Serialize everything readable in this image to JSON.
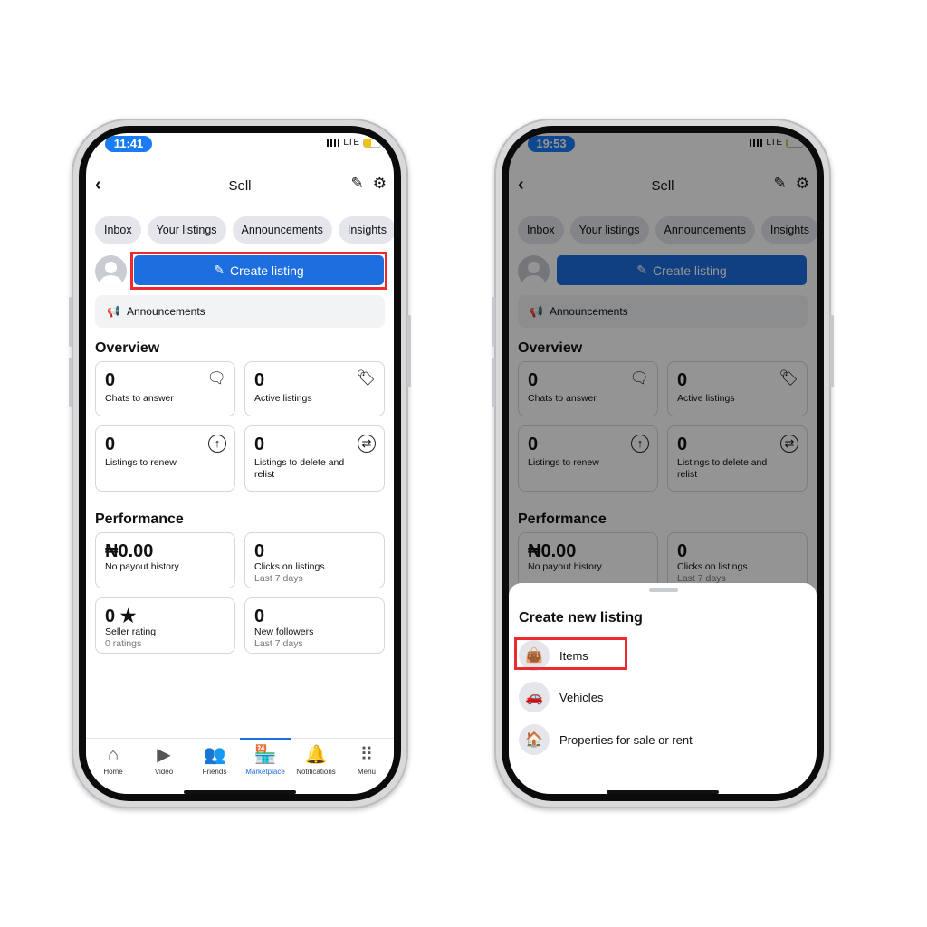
{
  "phones": [
    {
      "status": {
        "time": "11:41",
        "network": "LTE",
        "battery_level": 0.45,
        "battery_color": "#f5c400"
      },
      "header": {
        "title": "Sell",
        "back_icon": "‹",
        "edit_icon": "✎",
        "settings_icon": "⚙"
      },
      "tabs": [
        "Inbox",
        "Your listings",
        "Announcements",
        "Insights"
      ],
      "create_listing": {
        "label": "Create listing",
        "icon": "✎",
        "highlighted": true
      },
      "announcements": {
        "label": "Announcements",
        "icon": "📢"
      },
      "overview": {
        "title": "Overview",
        "cards": [
          {
            "value": "0",
            "label": "Chats to answer",
            "icon": "🗨"
          },
          {
            "value": "0",
            "label": "Active listings",
            "icon": "🏷"
          },
          {
            "value": "0",
            "label": "Listings to renew",
            "icon": "↑"
          },
          {
            "value": "0",
            "label": "Listings to delete and relist",
            "icon": "⇄"
          }
        ]
      },
      "performance": {
        "title": "Performance",
        "cards": [
          {
            "value": "₦0.00",
            "label": "No payout history",
            "sub": ""
          },
          {
            "value": "0",
            "label": "Clicks on listings",
            "sub": "Last 7 days"
          },
          {
            "value": "0 ★",
            "label": "Seller rating",
            "sub": "0 ratings"
          },
          {
            "value": "0",
            "label": "New followers",
            "sub": "Last 7 days"
          }
        ]
      },
      "nav": [
        {
          "label": "Home",
          "icon": "⌂",
          "active": false
        },
        {
          "label": "Video",
          "icon": "▶",
          "active": false
        },
        {
          "label": "Friends",
          "icon": "👥",
          "active": false
        },
        {
          "label": "Marketplace",
          "icon": "🏪",
          "active": true
        },
        {
          "label": "Notifications",
          "icon": "🔔",
          "active": false
        },
        {
          "label": "Menu",
          "icon": "⠿",
          "active": false
        }
      ]
    },
    {
      "status": {
        "time": "19:53",
        "network": "LTE",
        "battery_level": 0.12,
        "battery_color": "#f5c400"
      },
      "header": {
        "title": "Sell"
      },
      "tabs": [
        "Inbox",
        "Your listings",
        "Announcements",
        "Insights"
      ],
      "create_listing": {
        "label": "Create listing"
      },
      "announcements": {
        "label": "Announcements"
      },
      "overview": {
        "title": "Overview",
        "cards": [
          {
            "value": "0",
            "label": "Chats to answer"
          },
          {
            "value": "0",
            "label": "Active listings"
          },
          {
            "value": "0",
            "label": "Listings to renew"
          },
          {
            "value": "0",
            "label": "Listings to delete and relist"
          }
        ]
      },
      "performance": {
        "title": "Performance",
        "cards": [
          {
            "value": "₦0.00",
            "label": "No payout history",
            "sub": ""
          },
          {
            "value": "0",
            "label": "Clicks on listings",
            "sub": "Last 7 days"
          }
        ]
      },
      "sheet": {
        "title": "Create new listing",
        "options": [
          {
            "label": "Items",
            "icon": "👜",
            "highlighted": true
          },
          {
            "label": "Vehicles",
            "icon": "🚗",
            "highlighted": false
          },
          {
            "label": "Properties for sale or rent",
            "icon": "🏠",
            "highlighted": false
          }
        ]
      }
    }
  ],
  "colors": {
    "accent": "#1d6fe0",
    "highlight": "#ee2a2f"
  }
}
